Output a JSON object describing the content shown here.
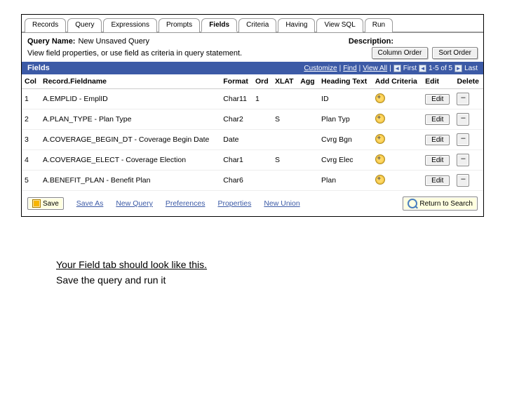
{
  "tabs": [
    "Records",
    "Query",
    "Expressions",
    "Prompts",
    "Fields",
    "Criteria",
    "Having",
    "View SQL",
    "Run"
  ],
  "activeTab": 4,
  "meta": {
    "queryNameLabel": "Query Name:",
    "queryNameValue": "New Unsaved Query",
    "descriptionLabel": "Description:"
  },
  "instruction": "View field properties, or use field as criteria in query statement.",
  "topButtons": {
    "columnOrder": "Column Order",
    "sortOrder": "Sort Order"
  },
  "section": {
    "title": "Fields",
    "toolbar": {
      "customize": "Customize",
      "find": "Find",
      "viewAll": "View All",
      "first": "First",
      "counter": "1-5 of 5",
      "last": "Last"
    }
  },
  "columns": {
    "col": "Col",
    "fieldname": "Record.Fieldname",
    "format": "Format",
    "ord": "Ord",
    "xlat": "XLAT",
    "agg": "Agg",
    "heading": "Heading Text",
    "addCriteria": "Add Criteria",
    "edit": "Edit",
    "delete": "Delete"
  },
  "rows": [
    {
      "col": "1",
      "rec": "A.EMPLID - EmplID",
      "format": "Char11",
      "ord": "1",
      "xlat": "",
      "heading": "ID"
    },
    {
      "col": "2",
      "rec": "A.PLAN_TYPE - Plan Type",
      "format": "Char2",
      "ord": "",
      "xlat": "S",
      "heading": "Plan Typ"
    },
    {
      "col": "3",
      "rec": "A.COVERAGE_BEGIN_DT - Coverage Begin Date",
      "format": "Date",
      "ord": "",
      "xlat": "",
      "heading": "Cvrg Bgn"
    },
    {
      "col": "4",
      "rec": "A.COVERAGE_ELECT - Coverage Election",
      "format": "Char1",
      "ord": "",
      "xlat": "S",
      "heading": "Cvrg Elec"
    },
    {
      "col": "5",
      "rec": "A.BENEFIT_PLAN - Benefit Plan",
      "format": "Char6",
      "ord": "",
      "xlat": "",
      "heading": "Plan"
    }
  ],
  "editLabel": "Edit",
  "deleteLabel": "–",
  "footer": {
    "save": "Save",
    "saveAs": "Save As",
    "newQuery": "New Query",
    "preferences": "Preferences",
    "properties": "Properties",
    "newUnion": "New Union",
    "returnToSearch": "Return to Search"
  },
  "captions": {
    "line1": "Your Field tab should look like this.",
    "line2": "Save the query and run it"
  }
}
